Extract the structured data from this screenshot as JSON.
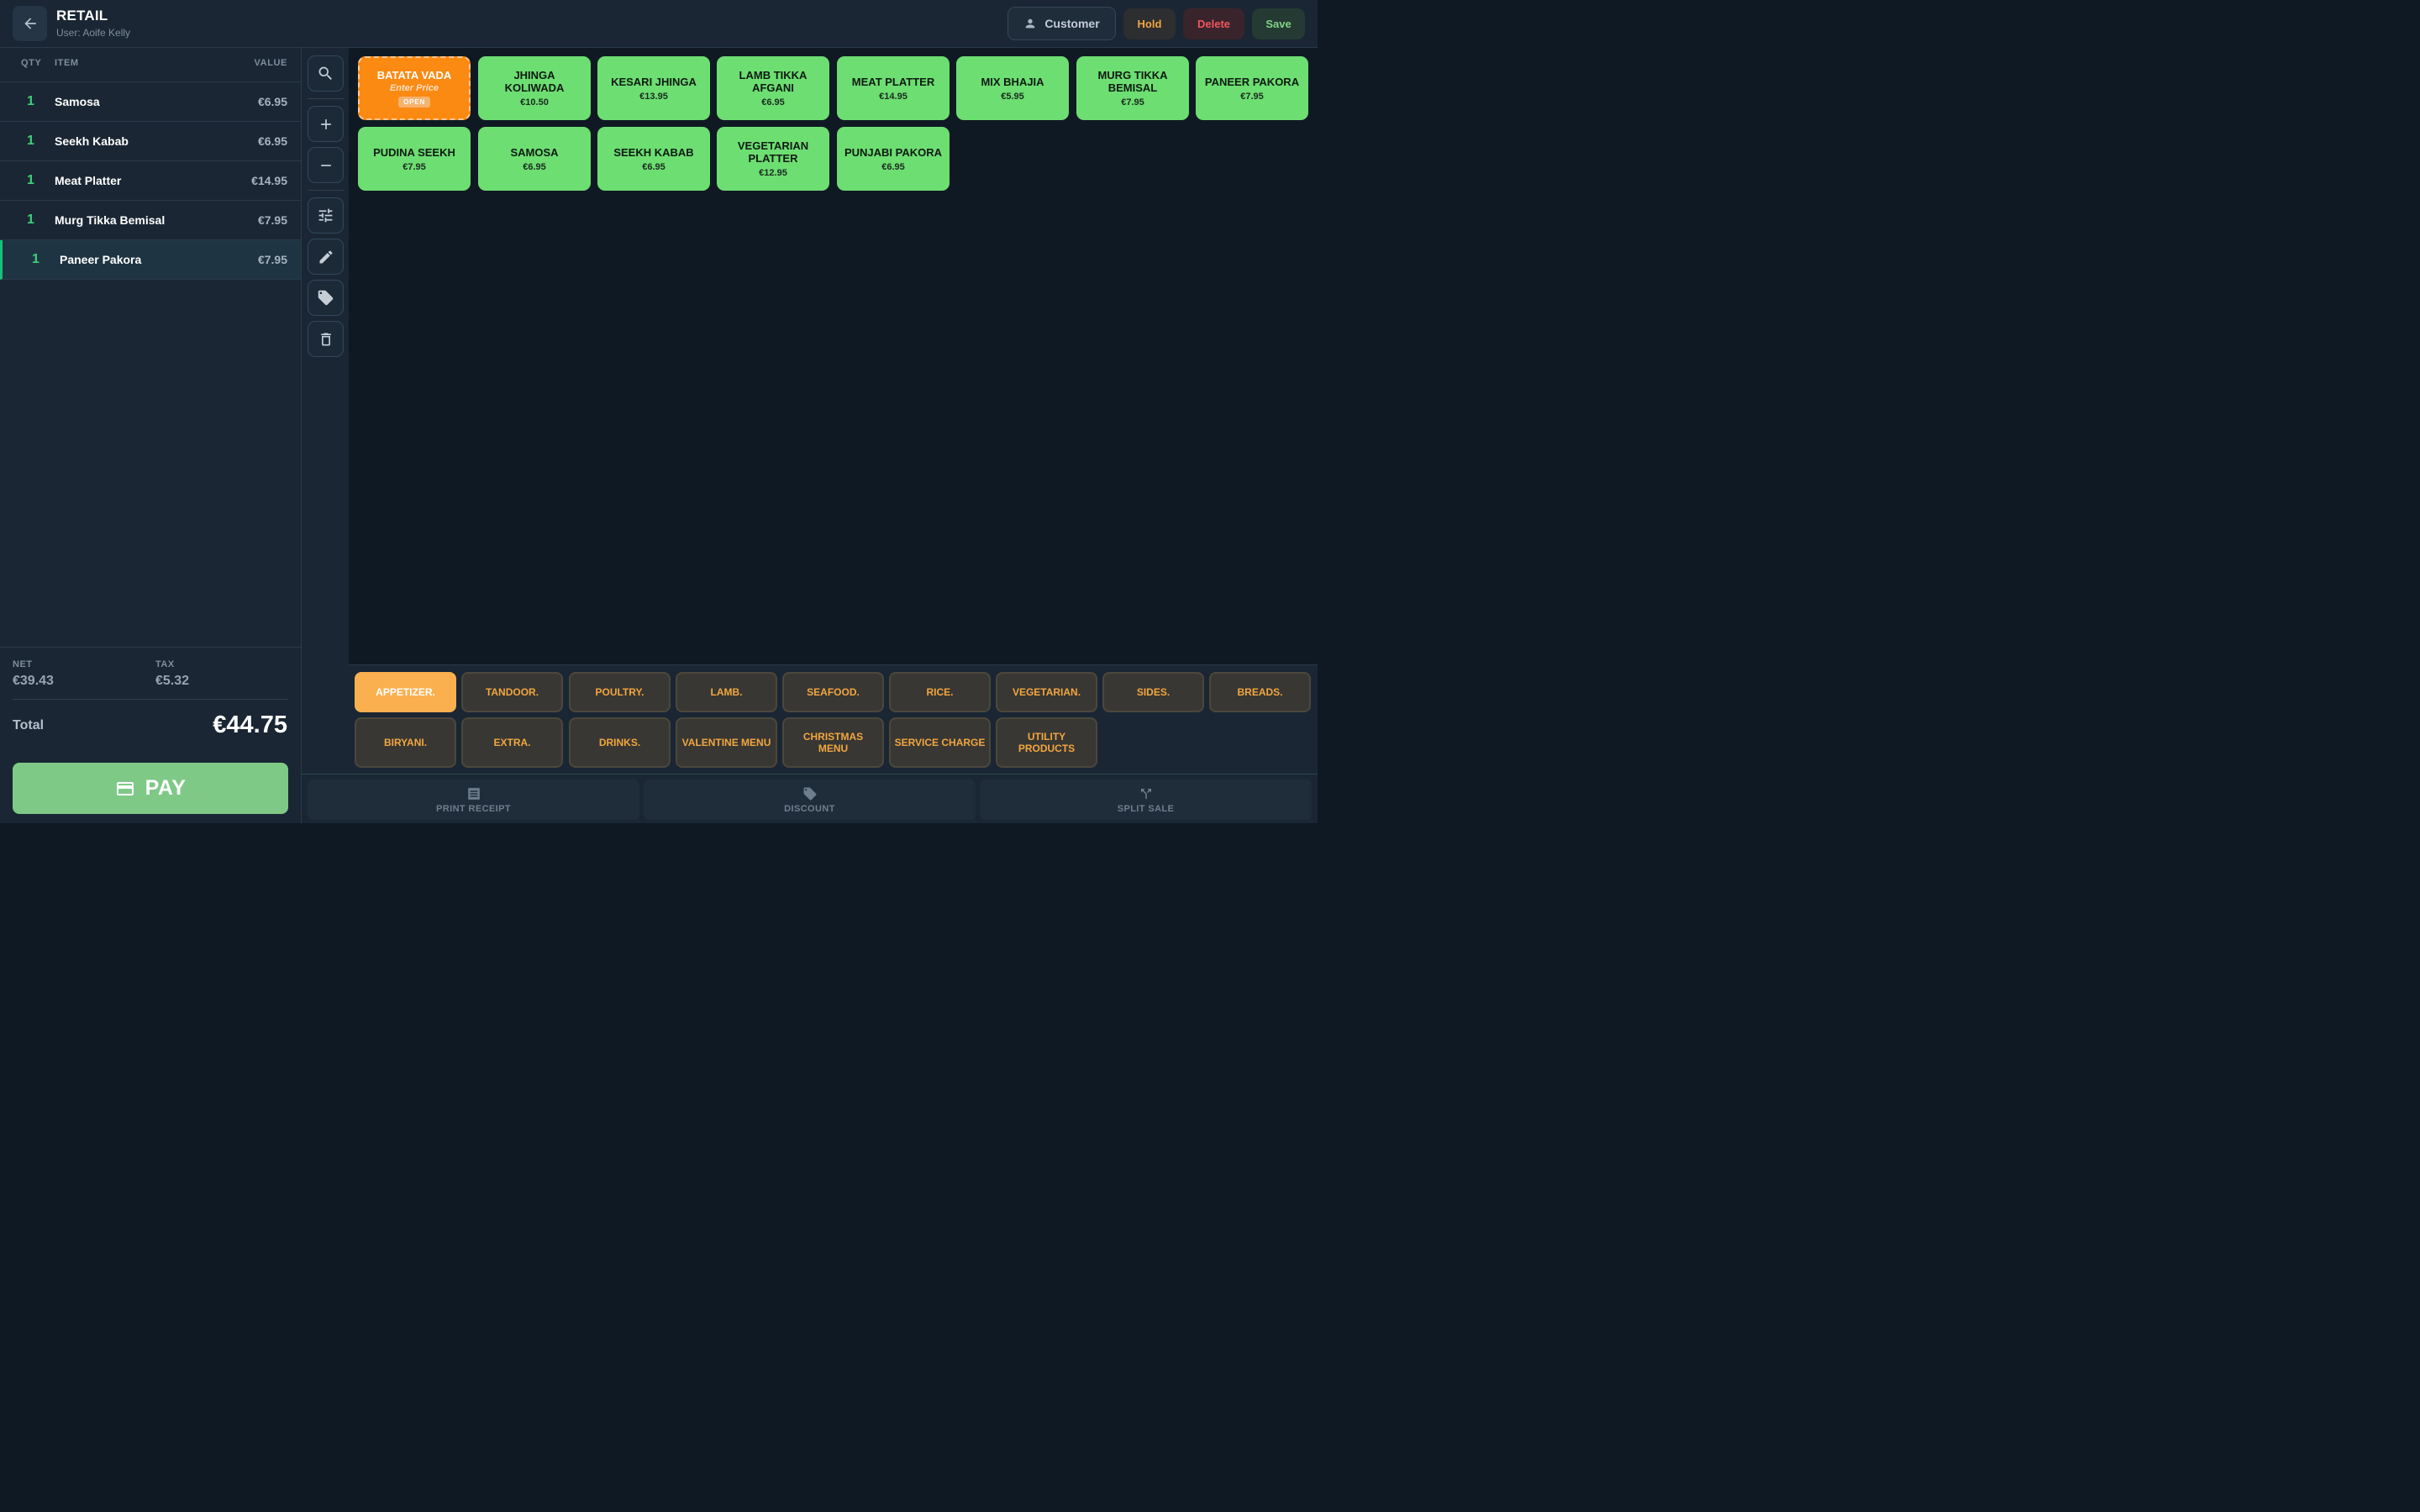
{
  "header": {
    "title": "RETAIL",
    "user": "User: Aoife Kelly",
    "customer_label": "Customer",
    "hold_label": "Hold",
    "delete_label": "Delete",
    "save_label": "Save"
  },
  "order": {
    "columns": {
      "qty": "QTY",
      "item": "ITEM",
      "value": "VALUE"
    },
    "items": [
      {
        "qty": "1",
        "name": "Samosa",
        "value": "€6.95"
      },
      {
        "qty": "1",
        "name": "Seekh Kabab",
        "value": "€6.95"
      },
      {
        "qty": "1",
        "name": "Meat Platter",
        "value": "€14.95"
      },
      {
        "qty": "1",
        "name": "Murg Tikka Bemisal",
        "value": "€7.95"
      },
      {
        "qty": "1",
        "name": "Paneer Pakora",
        "value": "€7.95"
      }
    ],
    "selected_index": 4,
    "net_label": "NET",
    "net_value": "€39.43",
    "tax_label": "TAX",
    "tax_value": "€5.32",
    "total_label": "Total",
    "total_value": "€44.75",
    "pay_label": "PAY"
  },
  "tools": [
    "search-icon",
    "plus-icon",
    "minus-icon",
    "tune-icon",
    "pencil-icon",
    "tag-icon",
    "trash-icon"
  ],
  "products": [
    {
      "name": "BATATA VADA",
      "sub": "Enter Price",
      "tag": "OPEN",
      "open": true
    },
    {
      "name": "JHINGA KOLIWADA",
      "price": "€10.50"
    },
    {
      "name": "KESARI JHINGA",
      "price": "€13.95"
    },
    {
      "name": "LAMB TIKKA AFGANI",
      "price": "€6.95"
    },
    {
      "name": "MEAT PLATTER",
      "price": "€14.95"
    },
    {
      "name": "MIX BHAJIA",
      "price": "€5.95"
    },
    {
      "name": "MURG TIKKA BEMISAL",
      "price": "€7.95"
    },
    {
      "name": "PANEER PAKORA",
      "price": "€7.95"
    },
    {
      "name": "PUDINA SEEKH",
      "price": "€7.95"
    },
    {
      "name": "SAMOSA",
      "price": "€6.95"
    },
    {
      "name": "SEEKH KABAB",
      "price": "€6.95"
    },
    {
      "name": "VEGETARIAN PLATTER",
      "price": "€12.95"
    },
    {
      "name": "PUNJABI PAKORA",
      "price": "€6.95"
    }
  ],
  "categories": [
    {
      "label": "APPETIZER.",
      "active": true
    },
    {
      "label": "TANDOOR."
    },
    {
      "label": "POULTRY."
    },
    {
      "label": "LAMB."
    },
    {
      "label": "SEAFOOD."
    },
    {
      "label": "RICE."
    },
    {
      "label": "VEGETARIAN."
    },
    {
      "label": "SIDES."
    },
    {
      "label": "BREADS."
    },
    {
      "label": "BIRYANI."
    },
    {
      "label": "EXTRA."
    },
    {
      "label": "DRINKS."
    },
    {
      "label": "VALENTINE MENU"
    },
    {
      "label": "CHRISTMAS MENU"
    },
    {
      "label": "SERVICE CHARGE"
    },
    {
      "label": "UTILITY PRODUCTS"
    }
  ],
  "actions": [
    {
      "label": "PRINT RECEIPT",
      "icon": "receipt-icon"
    },
    {
      "label": "DISCOUNT",
      "icon": "tag-icon"
    },
    {
      "label": "SPLIT SALE",
      "icon": "split-icon"
    }
  ],
  "colors": {
    "product_green": "#6dde72",
    "open_orange": "#fb8a12",
    "category_text": "#f2a640",
    "active_category": "#fbb04f",
    "qty_green": "#3ecf7a",
    "pay_green": "#7fc987"
  }
}
